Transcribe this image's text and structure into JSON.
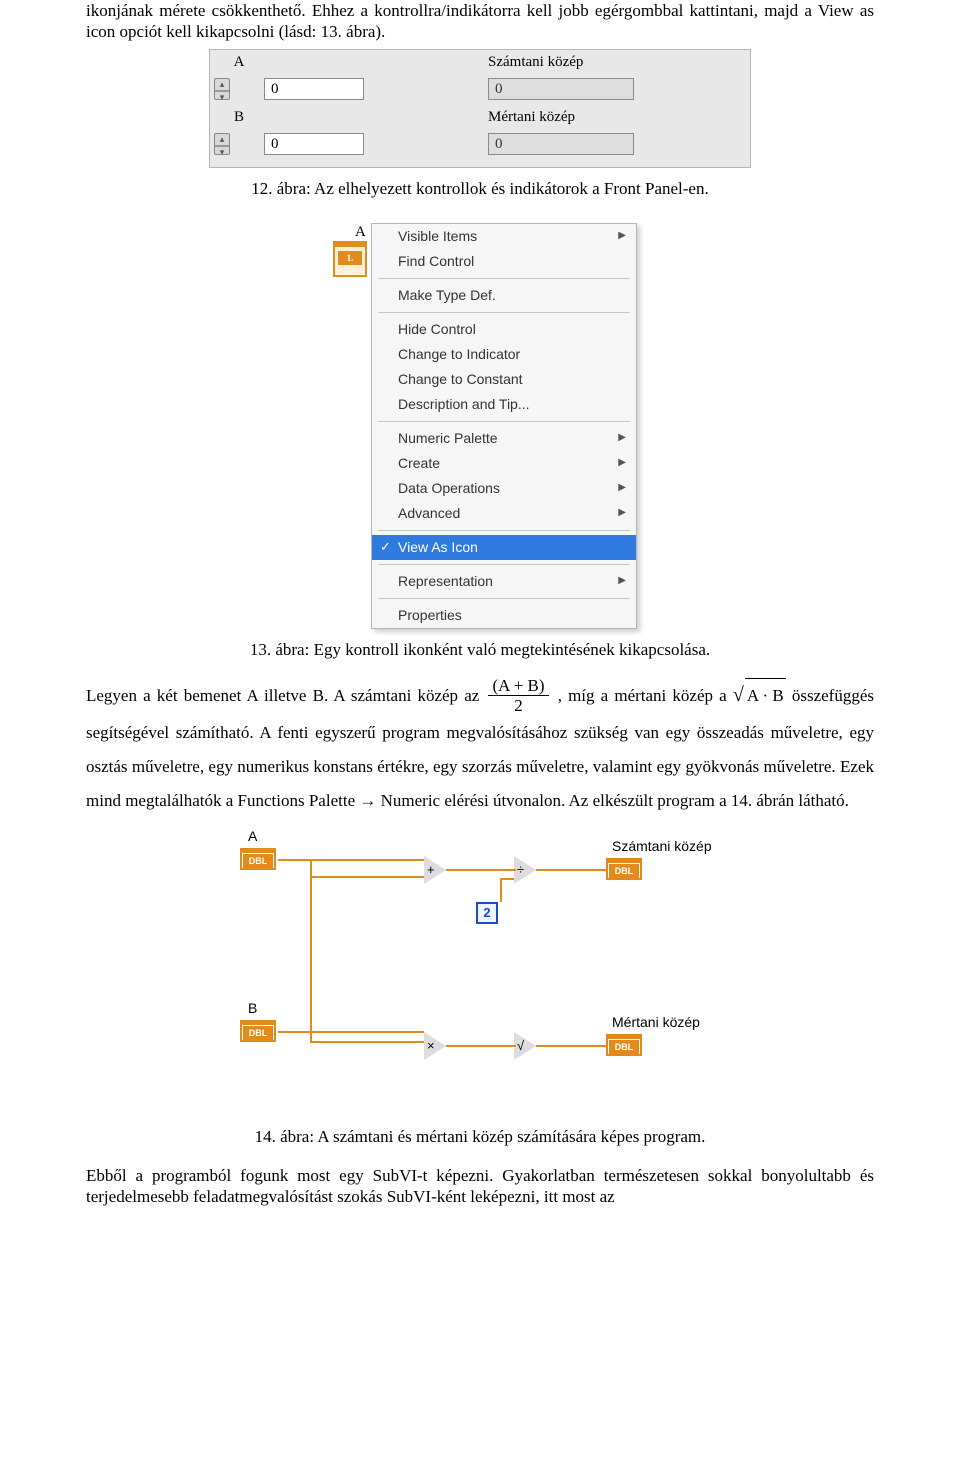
{
  "p_top": "ikonjának mérete csökkenthető. Ehhez a kontrollra/indikátorra kell jobb egérgombbal kattintani, majd a View as icon opciót kell kikapcsolni (lásd: 13. ábra).",
  "fig12": {
    "labA": "A",
    "labSz": "Számtani közép",
    "labB": "B",
    "labM": "Mértani közép",
    "valCtrl": "0",
    "valInd": "0",
    "caption": "12. ábra: Az elhelyezett kontrollok és indikátorok a Front Panel-en."
  },
  "fig13": {
    "label": "A",
    "dbl": "1.",
    "menu": {
      "visible": "Visible Items",
      "find": "Find Control",
      "maketype": "Make Type Def.",
      "hide": "Hide Control",
      "chind": "Change to Indicator",
      "chconst": "Change to Constant",
      "desc": "Description and Tip...",
      "numpal": "Numeric Palette",
      "create": "Create",
      "dataops": "Data Operations",
      "adv": "Advanced",
      "viewicon": "View As Icon",
      "repr": "Representation",
      "props": "Properties"
    },
    "caption": "13. ábra: Egy kontroll ikonként való megtekintésének kikapcsolása."
  },
  "math": {
    "t1": "Legyen a két bemenet A illetve B. A számtani közép az ",
    "num": "(A + B)",
    "den": "2",
    "t2": ", míg a mértani közép a ",
    "rad": "A · B",
    "t3": " összefüggés segítségével számítható. A fenti egyszerű program megvalósításához szükség van egy összeadás műveletre, egy osztás műveletre, egy numerikus konstans értékre, egy szorzás műveletre, valamint egy gyökvonás műveletre. Ezek mind megtalálhatók a Functions Palette → Numeric elérési útvonalon. Az elkészült program a 14. ábrán látható."
  },
  "fig14": {
    "labA": "A",
    "labSz": "Számtani közép",
    "labB": "B",
    "labM": "Mértani közép",
    "dbl": "DBL",
    "const2": "2",
    "caption": "14. ábra: A számtani és mértani közép számítására képes program."
  },
  "p_bot": "Ebből a programból fogunk most egy SubVI-t képezni. Gyakorlatban természetesen sokkal bonyolultabb és terjedelmesebb feladatmegvalósítást szokás SubVI-ként leképezni, itt most az"
}
